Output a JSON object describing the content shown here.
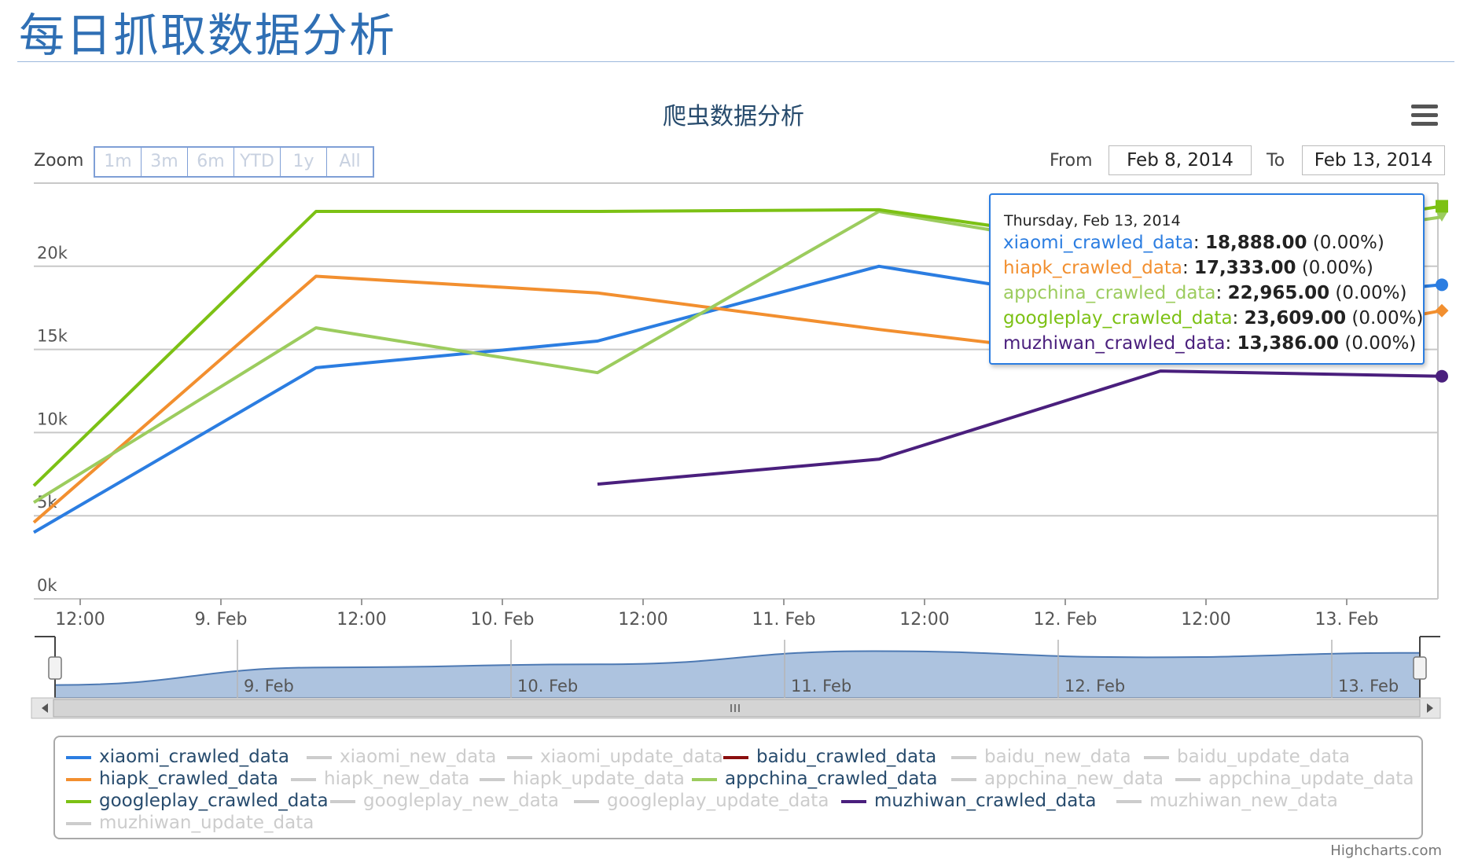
{
  "page": {
    "title": "每日抓取数据分析"
  },
  "toolbar": {
    "zoom_label": "Zoom",
    "zoom_buttons": [
      "1m",
      "3m",
      "6m",
      "YTD",
      "1y",
      "All"
    ],
    "from_label": "From",
    "from_value": "Feb 8, 2014",
    "to_label": "To",
    "to_value": "Feb 13, 2014"
  },
  "tooltip": {
    "date": "Thursday, Feb 13, 2014",
    "rows": [
      {
        "name": "xiaomi_crawled_data",
        "value": "18,888.00",
        "pct": "(0.00%)",
        "color": "#2b7de1"
      },
      {
        "name": "hiapk_crawled_data",
        "value": "17,333.00",
        "pct": "(0.00%)",
        "color": "#f28f2f"
      },
      {
        "name": "appchina_crawled_data",
        "value": "22,965.00",
        "pct": "(0.00%)",
        "color": "#9ccc5e"
      },
      {
        "name": "googleplay_crawled_data",
        "value": "23,609.00",
        "pct": "(0.00%)",
        "color": "#7cc114"
      },
      {
        "name": "muzhiwan_crawled_data",
        "value": "13,386.00",
        "pct": "(0.00%)",
        "color": "#4a1f7d"
      }
    ]
  },
  "chart_data": {
    "type": "line",
    "title": "爬虫数据分析",
    "x": [
      "2014-02-08 03:00",
      "2014-02-09 15:00",
      "2014-02-10 15:00",
      "2014-02-11 15:00",
      "2014-02-12 15:00",
      "2014-02-13 15:00"
    ],
    "ylim": [
      0,
      25000
    ],
    "y_ticks": [
      "0k",
      "5k",
      "10k",
      "15k",
      "20k"
    ],
    "x_ticks": [
      "12:00",
      "9. Feb",
      "12:00",
      "10. Feb",
      "12:00",
      "11. Feb",
      "12:00",
      "12. Feb",
      "12:00",
      "13. Feb"
    ],
    "grid": true,
    "series": [
      {
        "name": "xiaomi_crawled_data",
        "color": "#2b7de1",
        "values": [
          4000,
          13900,
          15500,
          20000,
          17300,
          18888
        ]
      },
      {
        "name": "hiapk_crawled_data",
        "color": "#f28f2f",
        "values": [
          4600,
          19400,
          18400,
          16200,
          14200,
          17333
        ]
      },
      {
        "name": "appchina_crawled_data",
        "color": "#9ccc5e",
        "values": [
          5800,
          16300,
          13600,
          23300,
          20500,
          22965
        ]
      },
      {
        "name": "googleplay_crawled_data",
        "color": "#7cc114",
        "values": [
          6800,
          23300,
          23300,
          23400,
          21000,
          23609
        ]
      },
      {
        "name": "muzhiwan_crawled_data",
        "color": "#4a1f7d",
        "values": [
          null,
          null,
          6900,
          8400,
          13700,
          13386
        ]
      }
    ],
    "navigator": {
      "labels": [
        "9. Feb",
        "10. Feb",
        "11. Feb",
        "12. Feb",
        "13. Feb"
      ],
      "values": [
        0.15,
        0.55,
        0.62,
        0.92,
        0.78,
        0.88
      ],
      "fill": "#adc3df"
    }
  },
  "legend": [
    {
      "name": "xiaomi_crawled_data",
      "color": "#2b7de1",
      "active": true
    },
    {
      "name": "xiaomi_new_data",
      "color": "#cccccc",
      "active": false
    },
    {
      "name": "xiaomi_update_data",
      "color": "#cccccc",
      "active": false
    },
    {
      "name": "baidu_crawled_data",
      "color": "#8b0f0f",
      "active": true
    },
    {
      "name": "baidu_new_data",
      "color": "#cccccc",
      "active": false
    },
    {
      "name": "baidu_update_data",
      "color": "#cccccc",
      "active": false
    },
    {
      "name": "hiapk_crawled_data",
      "color": "#f28f2f",
      "active": true
    },
    {
      "name": "hiapk_new_data",
      "color": "#cccccc",
      "active": false
    },
    {
      "name": "hiapk_update_data",
      "color": "#cccccc",
      "active": false
    },
    {
      "name": "appchina_crawled_data",
      "color": "#9ccc5e",
      "active": true
    },
    {
      "name": "appchina_new_data",
      "color": "#cccccc",
      "active": false
    },
    {
      "name": "appchina_update_data",
      "color": "#cccccc",
      "active": false
    },
    {
      "name": "googleplay_crawled_data",
      "color": "#7cc114",
      "active": true
    },
    {
      "name": "googleplay_new_data",
      "color": "#cccccc",
      "active": false
    },
    {
      "name": "googleplay_update_data",
      "color": "#cccccc",
      "active": false
    },
    {
      "name": "muzhiwan_crawled_data",
      "color": "#4a1f7d",
      "active": true
    },
    {
      "name": "muzhiwan_new_data",
      "color": "#cccccc",
      "active": false
    },
    {
      "name": "muzhiwan_update_data",
      "color": "#cccccc",
      "active": false
    }
  ],
  "credits": "Highcharts.com",
  "icons": {
    "menu": "hamburger-menu-icon",
    "scroll_left": "triangle-left-icon",
    "scroll_right": "triangle-right-icon",
    "grip": "grip-icon"
  }
}
